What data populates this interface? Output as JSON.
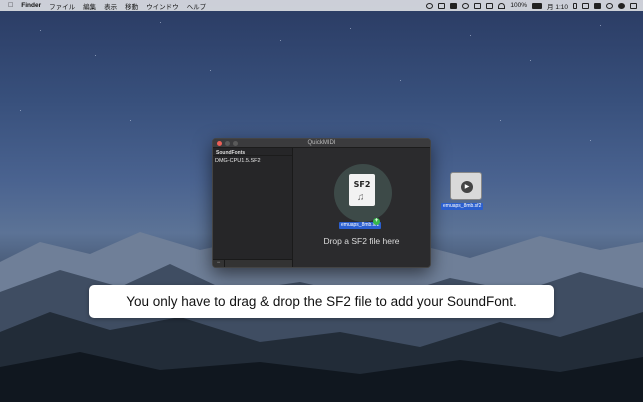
{
  "menubar": {
    "apple_icon": "apple-logo",
    "app_name": "Finder",
    "items": [
      "ファイル",
      "編集",
      "表示",
      "移動",
      "ウインドウ",
      "ヘルプ"
    ],
    "battery": "100%",
    "time": "月 1:10"
  },
  "window": {
    "title": "QuickMIDI",
    "sidebar_header": "SoundFonts",
    "sidebar_items": [
      "DMG-CPU1.5.SF2"
    ],
    "remove_button": "−",
    "file_tag": "SF2",
    "dragged_file": "emuaps_8mb.sf2",
    "drop_text": "Drop a SF2 file here"
  },
  "desktop": {
    "file_label": "emuaps_8mb.sf2"
  },
  "caption": "You only have to drag & drop the SF2 file to add your SoundFont."
}
